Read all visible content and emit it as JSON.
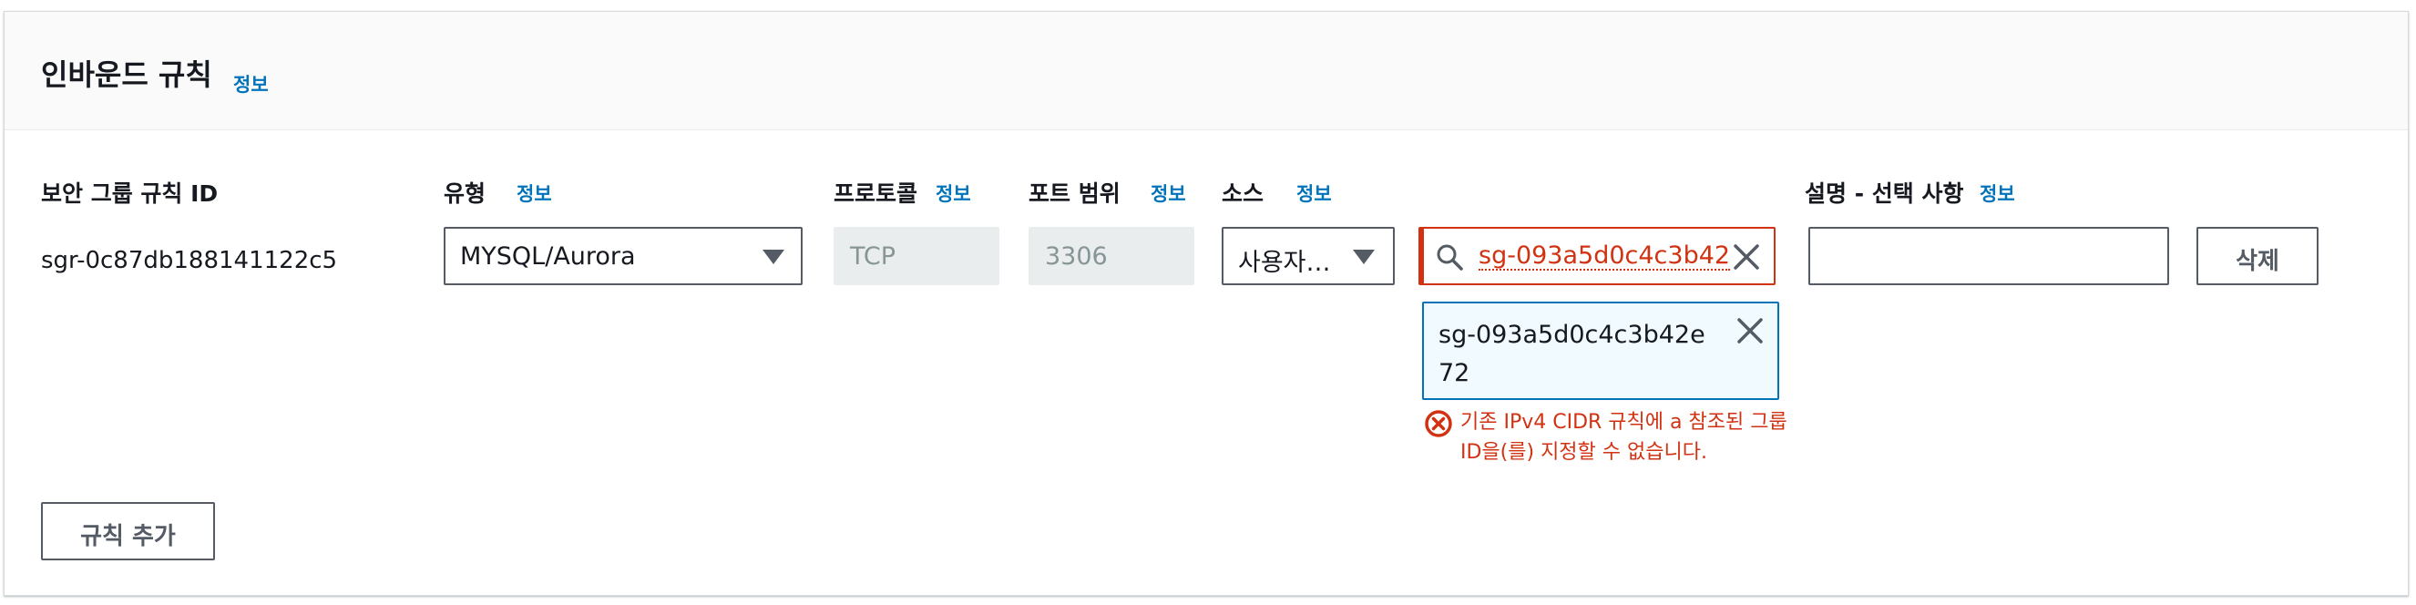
{
  "header": {
    "title": "인바운드 규칙",
    "info_link": "정보"
  },
  "columns": {
    "rule_id": {
      "label": "보안 그룹 규칙 ID"
    },
    "type": {
      "label": "유형",
      "info": "정보"
    },
    "protocol": {
      "label": "프로토콜",
      "info": "정보"
    },
    "port_range": {
      "label": "포트 범위",
      "info": "정보"
    },
    "source": {
      "label": "소스",
      "info": "정보"
    },
    "description": {
      "label": "설명 - 선택 사항",
      "info": "정보"
    }
  },
  "row": {
    "rule_id": "sgr-0c87db188141122c5",
    "type_value": "MYSQL/Aurora",
    "protocol_value": "TCP",
    "port_value": "3306",
    "source_value": "사용자…",
    "source_search_value": "sg-093a5d0c4c3b42",
    "token_value": "sg-093a5d0c4c3b42e72",
    "error_message": "기존 IPv4 CIDR 규칙에 a 참조된 그룹 ID을(를) 지정할 수 없습니다.",
    "description_value": "",
    "delete_label": "삭제"
  },
  "actions": {
    "add_rule_label": "규칙 추가"
  },
  "icons": {
    "search": "search-icon",
    "clear": "close-icon",
    "dismiss": "close-icon",
    "error": "error-icon",
    "dropdown": "caret-down-icon"
  },
  "colors": {
    "link": "#0073bb",
    "error": "#d13212",
    "token_bg": "#f1faff",
    "readonly_bg": "#eaeded"
  }
}
